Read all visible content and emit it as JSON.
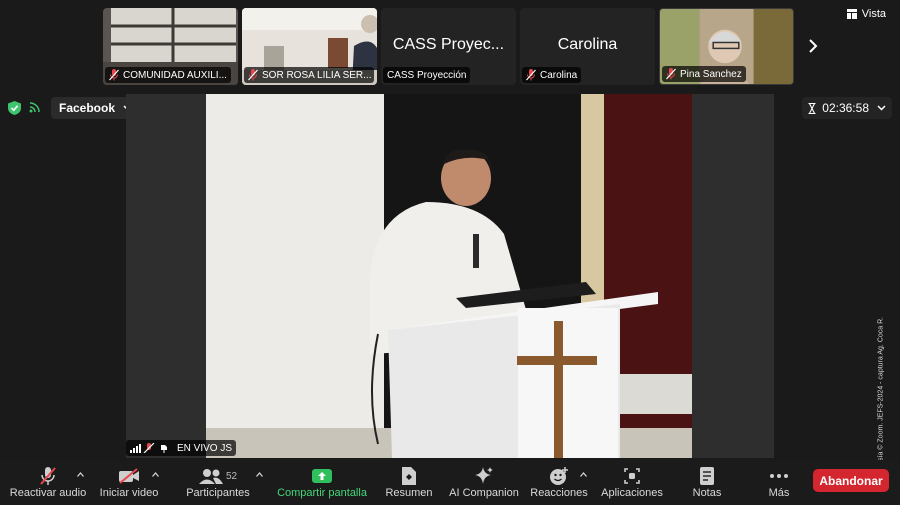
{
  "participants_strip": [
    {
      "name": "COMUNIDAD AUXILI...",
      "muted": true,
      "video": true
    },
    {
      "name": "SOR ROSA LILIA SER...",
      "muted": true,
      "video": true
    },
    {
      "name": "CASS Proyección",
      "display_name": "CASS Proyec...",
      "muted": false,
      "video": false
    },
    {
      "name": "Carolina",
      "display_name": "Carolina",
      "muted": true,
      "video": false
    },
    {
      "name": "Pina Sanchez",
      "muted": true,
      "video": true
    }
  ],
  "view_label": "Vista",
  "stream_label": "Facebook",
  "timer": "02:36:58",
  "speaker_tag": "EN VIVO JS",
  "credit": "Cortesía © Zoom. JEFS-2024 - captura Ag. Coca R.",
  "toolbar": {
    "audio": "Reactivar audio",
    "video": "Iniciar video",
    "participants": "Participantes",
    "participants_count": "52",
    "share": "Compartir pantalla",
    "summary": "Resumen",
    "ai": "AI Companion",
    "reactions": "Reacciones",
    "apps": "Aplicaciones",
    "notes": "Notas",
    "more": "Más",
    "leave": "Abandonar"
  },
  "colors": {
    "accent_green": "#43d97a",
    "leave_red": "#d3262f",
    "muted_red": "#e5484d"
  }
}
